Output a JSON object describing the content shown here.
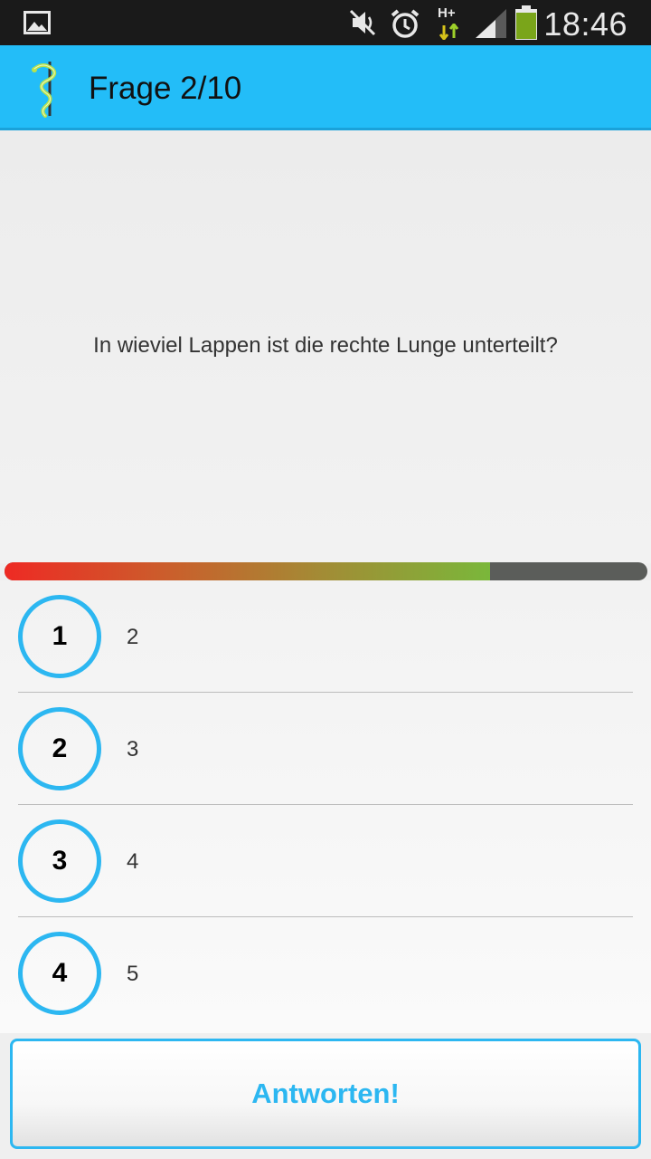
{
  "status_bar": {
    "time": "18:46",
    "network_type": "H+",
    "icons": [
      "gallery-icon",
      "mute-icon",
      "alarm-icon",
      "network-hplus-icon",
      "signal-icon",
      "battery-icon"
    ]
  },
  "action_bar": {
    "title": "Frage 2/10",
    "logo": "aesculapius-staff-icon",
    "background_color": "#23bdf8"
  },
  "question": {
    "text": "In wieviel Lappen ist die rechte Lunge unterteilt?"
  },
  "progress": {
    "fraction": 0.755
  },
  "answers": [
    {
      "number": "1",
      "text": "2"
    },
    {
      "number": "2",
      "text": "3"
    },
    {
      "number": "3",
      "text": "4"
    },
    {
      "number": "4",
      "text": "5"
    }
  ],
  "submit": {
    "label": "Antworten!"
  },
  "colors": {
    "accent": "#2cb7f1",
    "progress_start": "#ee2a24",
    "progress_end": "#7ab73a",
    "progress_track": "#5b5d5a"
  }
}
